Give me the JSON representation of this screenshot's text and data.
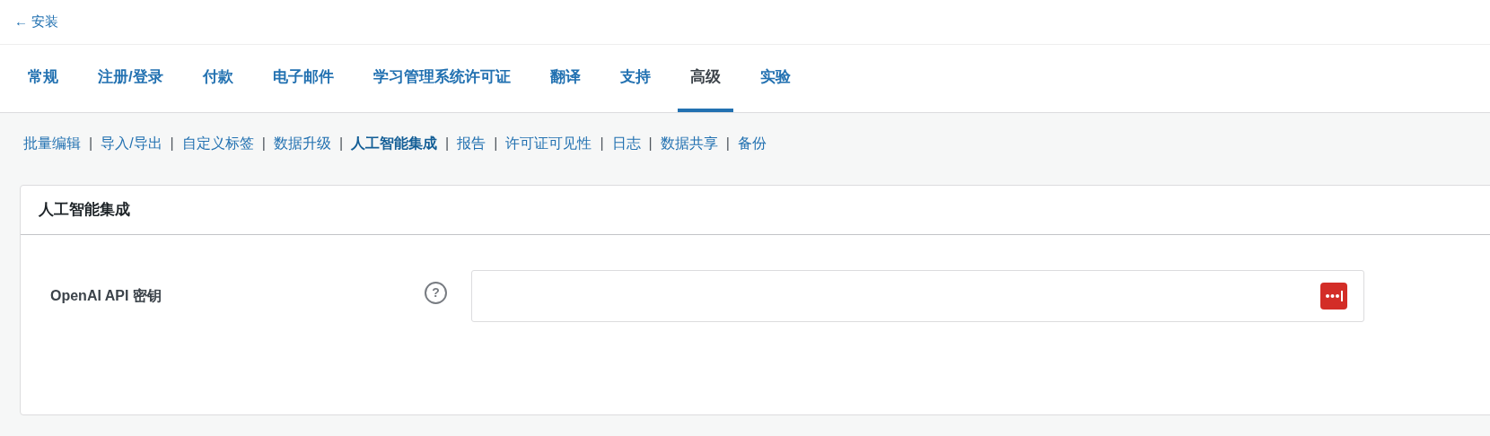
{
  "back_link": {
    "arrow": "←",
    "label": "安装"
  },
  "tabs": [
    {
      "label": "常规",
      "selected": false
    },
    {
      "label": "注册/登录",
      "selected": false
    },
    {
      "label": "付款",
      "selected": false
    },
    {
      "label": "电子邮件",
      "selected": false
    },
    {
      "label": "学习管理系统许可证",
      "selected": false
    },
    {
      "label": "翻译",
      "selected": false
    },
    {
      "label": "支持",
      "selected": false
    },
    {
      "label": "高级",
      "selected": true
    },
    {
      "label": "实验",
      "selected": false
    }
  ],
  "subnav": {
    "separator": "|",
    "items": [
      {
        "label": "批量编辑",
        "selected": false
      },
      {
        "label": "导入/导出",
        "selected": false
      },
      {
        "label": "自定义标签",
        "selected": false
      },
      {
        "label": "数据升级",
        "selected": false
      },
      {
        "label": "人工智能集成",
        "selected": true
      },
      {
        "label": "报告",
        "selected": false
      },
      {
        "label": "许可证可见性",
        "selected": false
      },
      {
        "label": "日志",
        "selected": false
      },
      {
        "label": "数据共享",
        "selected": false
      },
      {
        "label": "备份",
        "selected": false
      }
    ]
  },
  "card": {
    "title": "人工智能集成",
    "fields": [
      {
        "label": "OpenAI API 密钥",
        "help": "?"
      }
    ]
  }
}
